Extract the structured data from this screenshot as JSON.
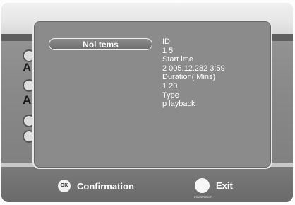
{
  "popup": {
    "highlighted_item": "Nol tems",
    "details": [
      "ID",
      "1 5",
      "Start ime",
      "2 005.12.282 3:59",
      "Duration( Mins)",
      "1 20",
      "Type",
      "p layback"
    ]
  },
  "background": {
    "side_letters": [
      "A",
      "A"
    ]
  },
  "footer": {
    "ok_icon_text": "OK",
    "confirm_label": "Confirmation",
    "exit_label": "Exit",
    "exit_icon_subtext": "POWER/EXIT"
  }
}
